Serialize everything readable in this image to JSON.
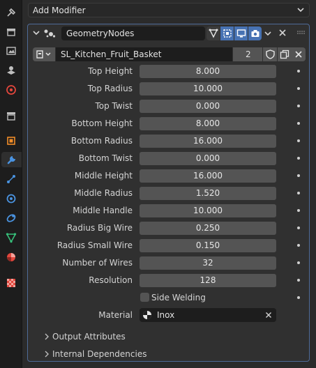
{
  "sidebar": {
    "tabs": [
      {
        "icon": "tool-icon",
        "color": "#bfbfbf",
        "active": false
      },
      {
        "icon": "render-icon",
        "color": "#bfbfbf",
        "active": false
      },
      {
        "icon": "output-icon",
        "color": "#bfbfbf",
        "active": false
      },
      {
        "icon": "view-layer-icon",
        "color": "#bfbfbf",
        "active": false
      },
      {
        "icon": "scene-icon",
        "color": "#bfbfbf",
        "active": false
      },
      {
        "icon": "world-icon",
        "color": "#e2463c",
        "active": false
      },
      {
        "icon": "collection-icon",
        "color": "#bfbfbf",
        "active": false
      },
      {
        "icon": "object-icon",
        "color": "#f08c28",
        "active": false
      },
      {
        "icon": "modifier-wrench-icon",
        "color": "#4a93e0",
        "active": true
      },
      {
        "icon": "particles-icon",
        "color": "#4a93e0",
        "active": false
      },
      {
        "icon": "physics-icon",
        "color": "#4a93e0",
        "active": false
      },
      {
        "icon": "constraints-icon",
        "color": "#4a93e0",
        "active": false
      },
      {
        "icon": "object-data-icon",
        "color": "#37c07a",
        "active": false
      },
      {
        "icon": "material-icon",
        "color": "#e2463c",
        "active": false
      },
      {
        "icon": "texture-icon",
        "color": "#e2463c",
        "active": false
      }
    ]
  },
  "add_modifier": {
    "label": "Add Modifier"
  },
  "modifier": {
    "name": "GeometryNodes",
    "node_group": {
      "name": "SL_Kitchen_Fruit_Basket",
      "users": "2"
    },
    "accent": "#4772b3",
    "params": [
      {
        "label": "Top Height",
        "value": "8.000"
      },
      {
        "label": "Top Radius",
        "value": "10.000"
      },
      {
        "label": "Top Twist",
        "value": "0.000"
      },
      {
        "label": "Bottom Height",
        "value": "8.000"
      },
      {
        "label": "Bottom Radius",
        "value": "16.000"
      },
      {
        "label": "Bottom Twist",
        "value": "0.000"
      },
      {
        "label": "Middle Height",
        "value": "16.000"
      },
      {
        "label": "Middle Radius",
        "value": "1.520"
      },
      {
        "label": "Middle Handle",
        "value": "10.000"
      },
      {
        "label": "Radius Big Wire",
        "value": "0.250"
      },
      {
        "label": "Radius Small Wire",
        "value": "0.150"
      },
      {
        "label": "Number of Wires",
        "value": "32"
      },
      {
        "label": "Resolution",
        "value": "128"
      }
    ],
    "side_welding": {
      "label": "Side Welding",
      "checked": false
    },
    "material": {
      "label": "Material",
      "value": "Inox"
    },
    "subpanels": [
      {
        "label": "Output Attributes",
        "expanded": false
      },
      {
        "label": "Internal Dependencies",
        "expanded": false
      }
    ]
  }
}
